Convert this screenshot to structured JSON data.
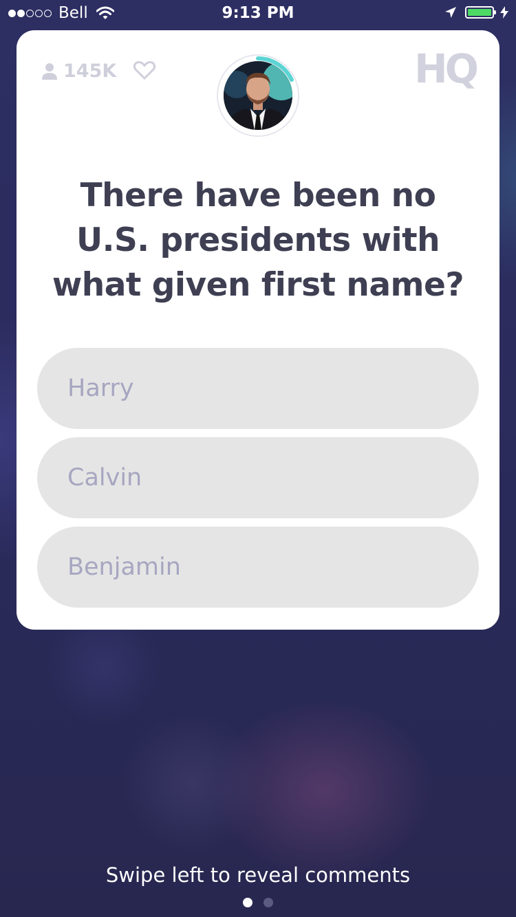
{
  "status_bar": {
    "carrier": "Bell",
    "signal_bars": 2,
    "signal_total": 5,
    "time": "9:13 PM",
    "battery_level": 1.0,
    "icons": [
      "wifi-icon",
      "location-arrow-icon",
      "battery-icon",
      "charging-bolt-icon"
    ]
  },
  "header": {
    "viewer_count": "145K",
    "viewer_icon": "person-icon",
    "like_icon": "heart-icon",
    "logo": "HQ",
    "host_avatar": "host-avatar",
    "timer_progress": 0.18,
    "timer_color": "#5cd4d4"
  },
  "question": {
    "text": "There have been no U.S. presidents with what given first name?"
  },
  "answers": [
    {
      "label": "Harry"
    },
    {
      "label": "Calvin"
    },
    {
      "label": "Benjamin"
    }
  ],
  "footer": {
    "hint": "Swipe left to reveal comments",
    "page_count": 2,
    "active_page": 0
  },
  "colors": {
    "question_text": "#3e3f52",
    "answer_background": "#e5e5e5",
    "answer_text": "#a7a6c1",
    "background": "#2b2b5c"
  }
}
